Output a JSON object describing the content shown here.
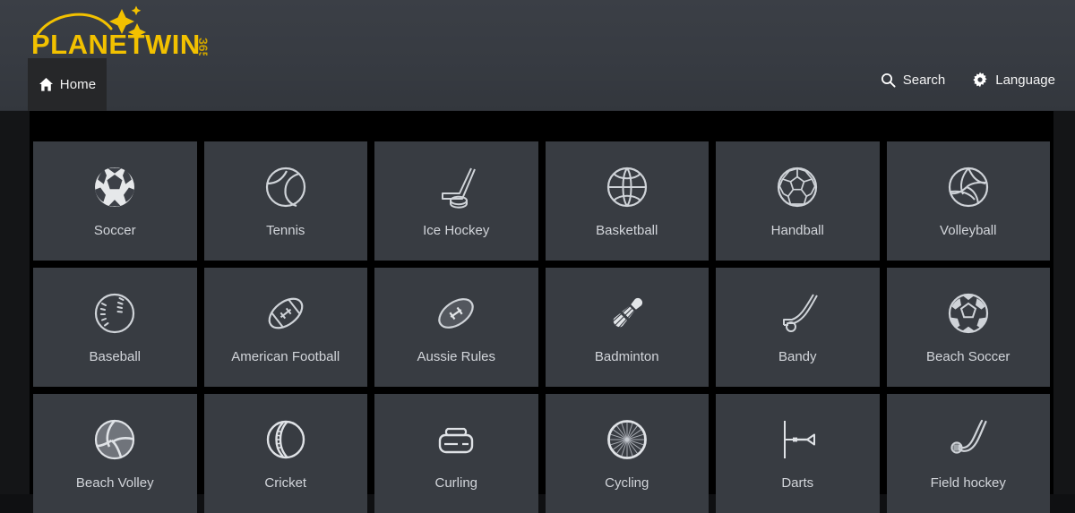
{
  "header": {
    "logo": {
      "brand_text": "PLANETWIN",
      "suffix_text": "365",
      "brand_color": "#f2c100"
    },
    "tabs": [
      {
        "label": "Home",
        "icon": "home-icon",
        "active": true
      }
    ],
    "nav": [
      {
        "label": "Search",
        "icon": "search-icon"
      },
      {
        "label": "Language",
        "icon": "gear-icon"
      }
    ]
  },
  "colors": {
    "header_bg": "#383c43",
    "tile_bg": "#383c42",
    "page_bg": "#141517",
    "grid_bg": "#000000",
    "label_text": "#d2d5da",
    "accent": "#f2c100"
  },
  "sports": [
    {
      "label": "Soccer",
      "icon": "soccer-ball-icon"
    },
    {
      "label": "Tennis",
      "icon": "tennis-ball-icon"
    },
    {
      "label": "Ice Hockey",
      "icon": "hockey-stick-puck-icon"
    },
    {
      "label": "Basketball",
      "icon": "basketball-icon"
    },
    {
      "label": "Handball",
      "icon": "handball-icon"
    },
    {
      "label": "Volleyball",
      "icon": "volleyball-icon"
    },
    {
      "label": "Baseball",
      "icon": "baseball-icon"
    },
    {
      "label": "American Football",
      "icon": "american-football-icon"
    },
    {
      "label": "Aussie Rules",
      "icon": "aussie-rules-ball-icon"
    },
    {
      "label": "Badminton",
      "icon": "shuttlecock-icon"
    },
    {
      "label": "Bandy",
      "icon": "bandy-stick-icon"
    },
    {
      "label": "Beach Soccer",
      "icon": "beach-soccer-ball-icon"
    },
    {
      "label": "Beach Volley",
      "icon": "beach-volleyball-icon"
    },
    {
      "label": "Cricket",
      "icon": "cricket-ball-icon"
    },
    {
      "label": "Curling",
      "icon": "curling-stone-icon"
    },
    {
      "label": "Cycling",
      "icon": "bicycle-wheel-icon"
    },
    {
      "label": "Darts",
      "icon": "dart-icon"
    },
    {
      "label": "Field hockey",
      "icon": "field-hockey-stick-icon"
    }
  ]
}
